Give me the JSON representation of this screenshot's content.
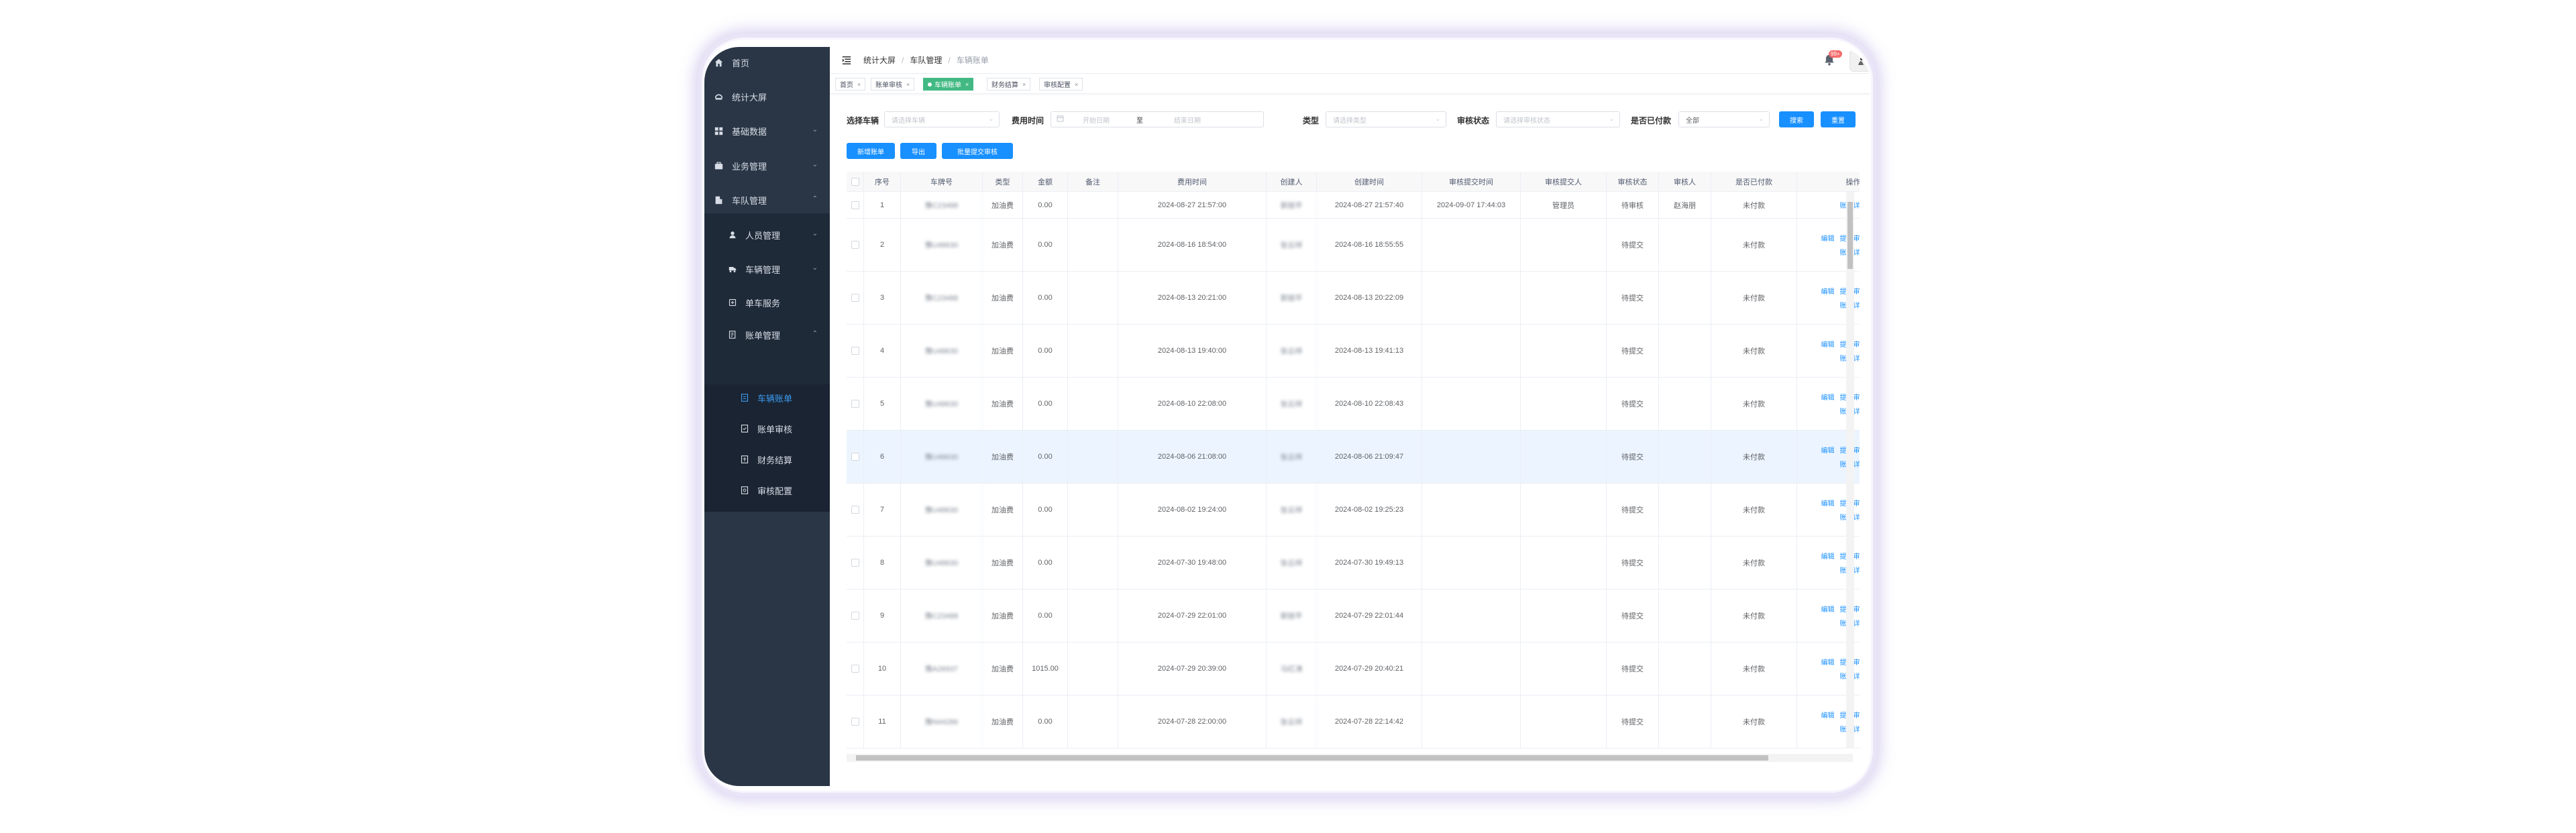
{
  "sidebar": {
    "items": [
      {
        "label": "首页",
        "icon": "home-icon"
      },
      {
        "label": "统计大屏",
        "icon": "dashboard-icon"
      },
      {
        "label": "基础数据",
        "icon": "grid-icon"
      },
      {
        "label": "业务管理",
        "icon": "briefcase-icon"
      },
      {
        "label": "车队管理",
        "icon": "building-icon"
      }
    ],
    "sub_items": [
      {
        "label": "人员管理",
        "icon": "person-icon"
      },
      {
        "label": "车辆管理",
        "icon": "truck-icon"
      },
      {
        "label": "单车服务",
        "icon": "service-icon"
      },
      {
        "label": "账单管理",
        "icon": "ledger-icon"
      }
    ],
    "sub_sub_items": [
      {
        "label": "车辆账单",
        "icon": "bill-icon"
      },
      {
        "label": "账单审核",
        "icon": "audit-icon"
      },
      {
        "label": "财务结算",
        "icon": "settle-icon"
      },
      {
        "label": "审核配置",
        "icon": "config-icon"
      }
    ]
  },
  "breadcrumb": [
    "统计大屏",
    "车队管理",
    "车辆账单"
  ],
  "notification": {
    "badge": "99+"
  },
  "tags": [
    "首页",
    "账单审核",
    "车辆账单",
    "财务结算",
    "审核配置"
  ],
  "filters": {
    "vehicle_label": "选择车辆",
    "vehicle_placeholder": "请选择车辆",
    "time_label": "费用时间",
    "start_placeholder": "开始日期",
    "range_sep": "至",
    "end_placeholder": "结束日期",
    "type_label": "类型",
    "type_placeholder": "请选择类型",
    "audit_label": "审核状态",
    "audit_placeholder": "请选择审核状态",
    "paid_label": "是否已付款",
    "paid_value": "全部",
    "search_btn": "搜索",
    "reset_btn": "重置"
  },
  "actions": {
    "add": "新增账单",
    "export": "导出",
    "batch": "批量提交审核"
  },
  "table": {
    "headers": [
      "序号",
      "车牌号",
      "类型",
      "金额",
      "备注",
      "费用时间",
      "创建人",
      "创建时间",
      "审核提交时间",
      "审核提交人",
      "审核状态",
      "审核人",
      "是否已付款",
      "操作"
    ],
    "ops": {
      "edit": "编辑",
      "submit": "提交审核",
      "delete": "删除",
      "detail": "账单详情"
    },
    "rows": [
      {
        "no": "1",
        "plate": "豫C23488",
        "type": "加油费",
        "amount": "0.00",
        "note": "",
        "fee_time": "2024-08-27 21:57:00",
        "creator": "郭丽平",
        "created": "2024-08-27 21:57:40",
        "submit_time": "2024-09-07 17:44:03",
        "submitter": "管理员",
        "status": "待审核",
        "auditor": "赵海朋",
        "paid": "未付款",
        "mode": "detail"
      },
      {
        "no": "2",
        "plate": "豫U48630",
        "type": "加油费",
        "amount": "0.00",
        "note": "",
        "fee_time": "2024-08-16 18:54:00",
        "creator": "张云祥",
        "created": "2024-08-16 18:55:55",
        "submit_time": "",
        "submitter": "",
        "status": "待提交",
        "auditor": "",
        "paid": "未付款",
        "mode": "full"
      },
      {
        "no": "3",
        "plate": "豫C23488",
        "type": "加油费",
        "amount": "0.00",
        "note": "",
        "fee_time": "2024-08-13 20:21:00",
        "creator": "郭丽平",
        "created": "2024-08-13 20:22:09",
        "submit_time": "",
        "submitter": "",
        "status": "待提交",
        "auditor": "",
        "paid": "未付款",
        "mode": "full"
      },
      {
        "no": "4",
        "plate": "豫U48630",
        "type": "加油费",
        "amount": "0.00",
        "note": "",
        "fee_time": "2024-08-13 19:40:00",
        "creator": "张云祥",
        "created": "2024-08-13 19:41:13",
        "submit_time": "",
        "submitter": "",
        "status": "待提交",
        "auditor": "",
        "paid": "未付款",
        "mode": "full"
      },
      {
        "no": "5",
        "plate": "豫U48630",
        "type": "加油费",
        "amount": "0.00",
        "note": "",
        "fee_time": "2024-08-10 22:08:00",
        "creator": "张云祥",
        "created": "2024-08-10 22:08:43",
        "submit_time": "",
        "submitter": "",
        "status": "待提交",
        "auditor": "",
        "paid": "未付款",
        "mode": "full"
      },
      {
        "no": "6",
        "plate": "豫U48630",
        "type": "加油费",
        "amount": "0.00",
        "note": "",
        "fee_time": "2024-08-06 21:08:00",
        "creator": "张云祥",
        "created": "2024-08-06 21:09:47",
        "submit_time": "",
        "submitter": "",
        "status": "待提交",
        "auditor": "",
        "paid": "未付款",
        "mode": "full"
      },
      {
        "no": "7",
        "plate": "豫U48630",
        "type": "加油费",
        "amount": "0.00",
        "note": "",
        "fee_time": "2024-08-02 19:24:00",
        "creator": "张云祥",
        "created": "2024-08-02 19:25:23",
        "submit_time": "",
        "submitter": "",
        "status": "待提交",
        "auditor": "",
        "paid": "未付款",
        "mode": "full"
      },
      {
        "no": "8",
        "plate": "豫U48630",
        "type": "加油费",
        "amount": "0.00",
        "note": "",
        "fee_time": "2024-07-30 19:48:00",
        "creator": "张云祥",
        "created": "2024-07-30 19:49:13",
        "submit_time": "",
        "submitter": "",
        "status": "待提交",
        "auditor": "",
        "paid": "未付款",
        "mode": "full"
      },
      {
        "no": "9",
        "plate": "豫C23488",
        "type": "加油费",
        "amount": "0.00",
        "note": "",
        "fee_time": "2024-07-29 22:01:00",
        "creator": "郭丽平",
        "created": "2024-07-29 22:01:44",
        "submit_time": "",
        "submitter": "",
        "status": "待提交",
        "auditor": "",
        "paid": "未付款",
        "mode": "full"
      },
      {
        "no": "10",
        "plate": "豫A26937",
        "type": "加油费",
        "amount": "1015.00",
        "note": "",
        "fee_time": "2024-07-29 20:39:00",
        "creator": "马红涛",
        "created": "2024-07-29 20:40:21",
        "submit_time": "",
        "submitter": "",
        "status": "待提交",
        "auditor": "",
        "paid": "未付款",
        "mode": "full"
      },
      {
        "no": "11",
        "plate": "豫N44286",
        "type": "加油费",
        "amount": "0.00",
        "note": "",
        "fee_time": "2024-07-28 22:00:00",
        "creator": "张云祥",
        "created": "2024-07-28 22:14:42",
        "submit_time": "",
        "submitter": "",
        "status": "待提交",
        "auditor": "",
        "paid": "未付款",
        "mode": "full"
      }
    ]
  }
}
